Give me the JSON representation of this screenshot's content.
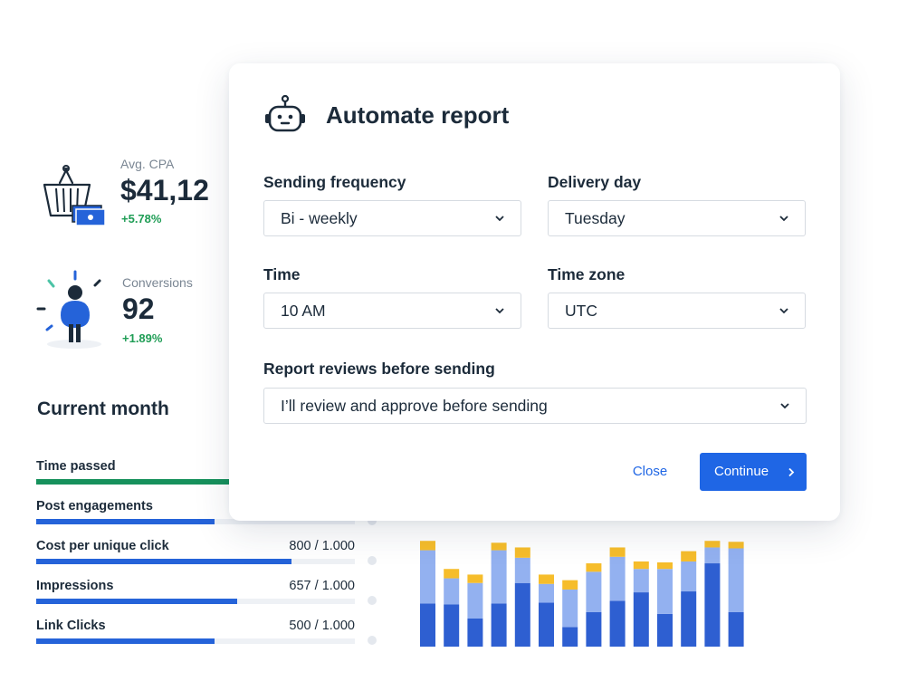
{
  "kpis": {
    "avg_cpa": {
      "label": "Avg. CPA",
      "value": "$41,12",
      "delta": "+5.78%",
      "icon": "shopping-basket-icon"
    },
    "conversions": {
      "label": "Conversions",
      "value": "92",
      "delta": "+1.89%",
      "icon": "person-icon"
    }
  },
  "current_month": {
    "title": "Current month",
    "metrics": [
      {
        "name": "Time passed",
        "value": "",
        "progress": 0.62,
        "color": "#16915c"
      },
      {
        "name": "Post engagements",
        "value": "",
        "progress": 0.56,
        "color": "#2563d9"
      },
      {
        "name": "Cost per unique click",
        "value": "800 / 1.000",
        "progress": 0.8,
        "color": "#2563d9"
      },
      {
        "name": "Impressions",
        "value": "657 / 1.000",
        "progress": 0.63,
        "color": "#2563d9"
      },
      {
        "name": "Link Clicks",
        "value": "500 / 1.000",
        "progress": 0.56,
        "color": "#2563d9"
      }
    ]
  },
  "chart_data": {
    "type": "bar",
    "stacked": true,
    "categories": [
      "",
      "",
      "",
      "",
      "",
      "",
      "",
      "",
      "",
      "",
      "",
      "",
      "",
      "",
      ""
    ],
    "series": [
      {
        "values": [
          46,
          45,
          30,
          46,
          68,
          47,
          21,
          37,
          49,
          58,
          35,
          59,
          89,
          37
        ]
      },
      {
        "values": [
          57,
          28,
          38,
          57,
          27,
          20,
          40,
          43,
          47,
          25,
          48,
          32,
          17,
          68
        ]
      },
      {
        "values": [
          10,
          10,
          9,
          8,
          11,
          10,
          10,
          9,
          10,
          8,
          7,
          11,
          7,
          7
        ]
      }
    ],
    "colors": [
      "#2e5fd1",
      "#93b1f0",
      "#f6bd2b"
    ],
    "ylim": [
      0,
      120
    ],
    "grid": false,
    "legend": "none"
  },
  "modal": {
    "title": "Automate report",
    "icon": "robot-icon",
    "sending_frequency": {
      "label": "Sending frequency",
      "value": "Bi - weekly"
    },
    "delivery_day": {
      "label": "Delivery day",
      "value": "Tuesday"
    },
    "time": {
      "label": "Time",
      "value": "10 AM"
    },
    "time_zone": {
      "label": "Time zone",
      "value": "UTC"
    },
    "review": {
      "label": "Report reviews before sending",
      "value": "I’ll review and approve before sending"
    },
    "close_label": "Close",
    "continue_label": "Continue",
    "accent": "#1f66e5"
  }
}
